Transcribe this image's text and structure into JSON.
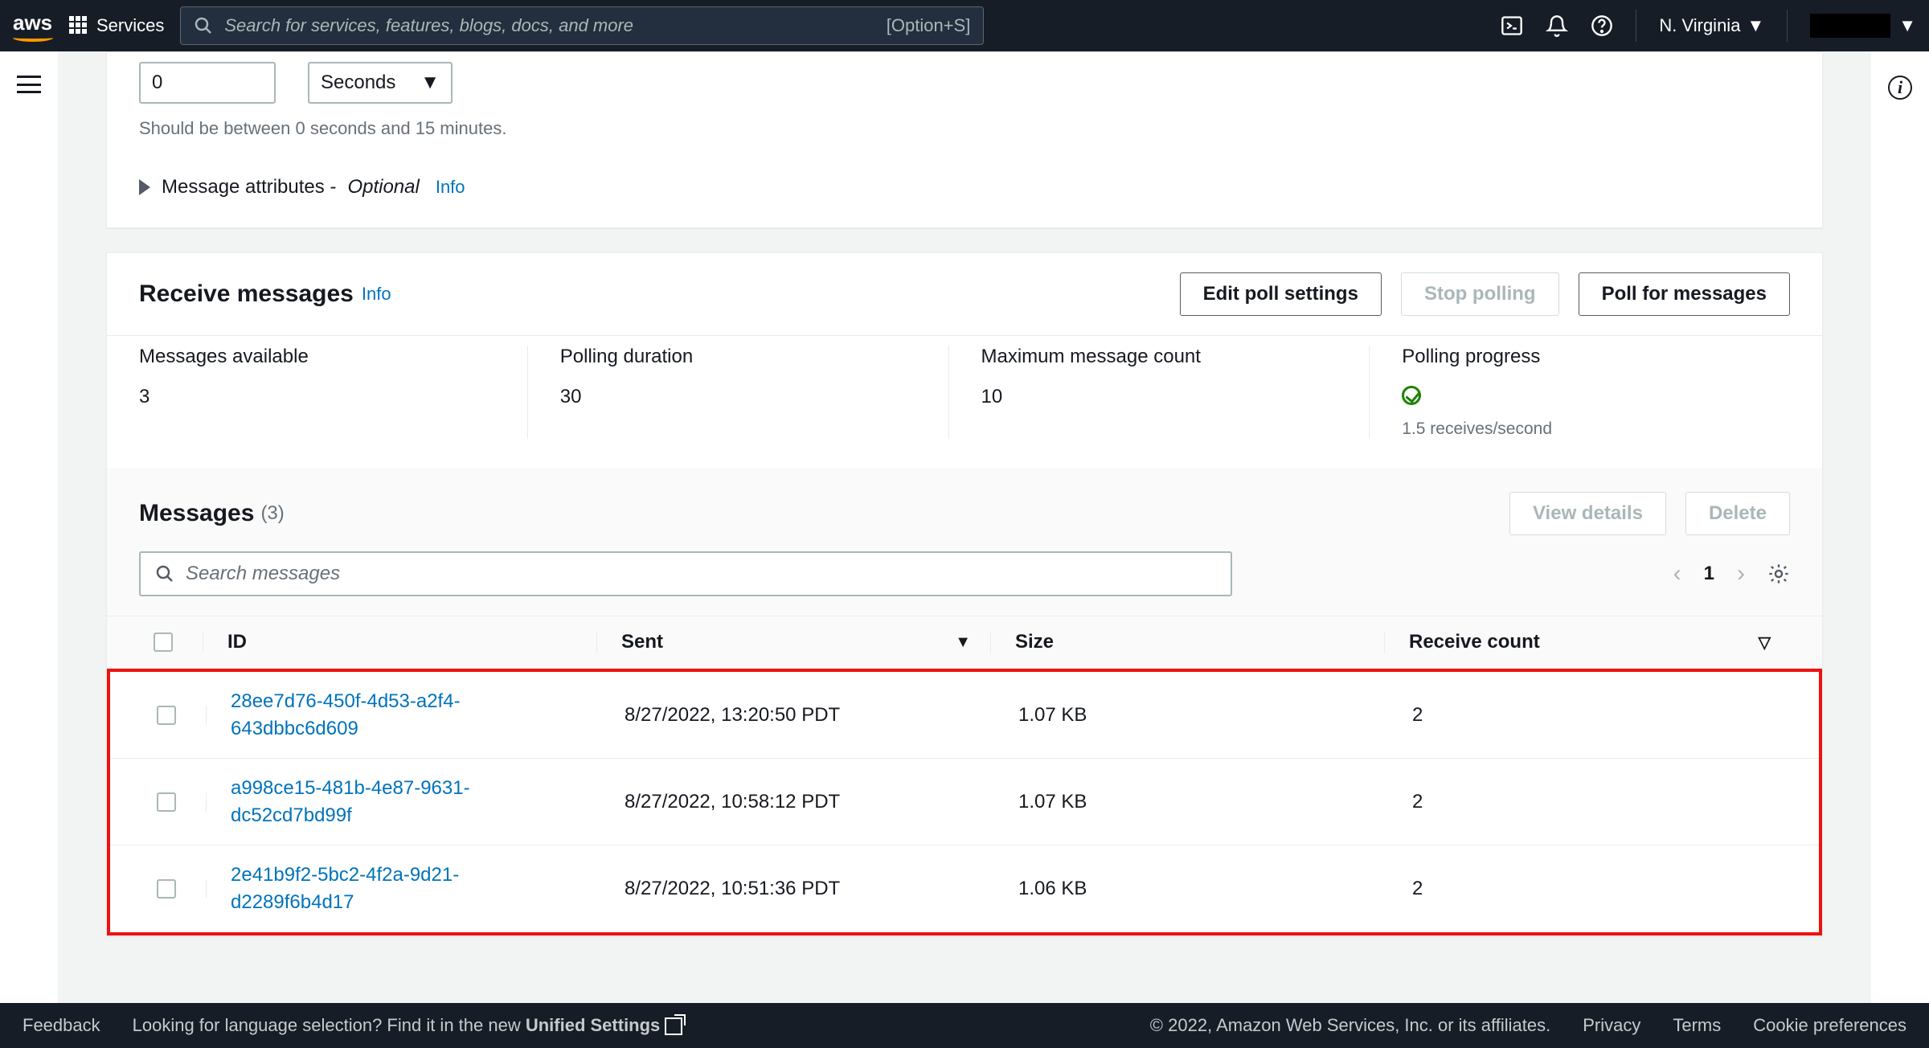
{
  "nav": {
    "logo_text": "aws",
    "services_label": "Services",
    "search_placeholder": "Search for services, features, blogs, docs, and more",
    "search_shortcut": "[Option+S]",
    "region": "N. Virginia"
  },
  "poll_panel": {
    "delay_value": "0",
    "unit_selected": "Seconds",
    "hint": "Should be between 0 seconds and 15 minutes.",
    "expander_label": "Message attributes - ",
    "expander_optional": "Optional",
    "expander_info": "Info"
  },
  "receive": {
    "title": "Receive messages",
    "info": "Info",
    "buttons": {
      "edit": "Edit poll settings",
      "stop": "Stop polling",
      "poll": "Poll for messages"
    },
    "stats": {
      "avail_label": "Messages available",
      "avail_val": "3",
      "dur_label": "Polling duration",
      "dur_val": "30",
      "max_label": "Maximum message count",
      "max_val": "10",
      "prog_label": "Polling progress",
      "prog_text": "1.5 receives/second"
    }
  },
  "messages_section": {
    "title": "Messages",
    "count": "(3)",
    "view_details": "View details",
    "delete": "Delete",
    "search_placeholder": "Search messages",
    "page": "1",
    "columns": {
      "id": "ID",
      "sent": "Sent",
      "size": "Size",
      "rc": "Receive count"
    },
    "rows": [
      {
        "id": "28ee7d76-450f-4d53-a2f4-643dbbc6d609",
        "sent": "8/27/2022, 13:20:50 PDT",
        "size": "1.07 KB",
        "rc": "2"
      },
      {
        "id": "a998ce15-481b-4e87-9631-dc52cd7bd99f",
        "sent": "8/27/2022, 10:58:12 PDT",
        "size": "1.07 KB",
        "rc": "2"
      },
      {
        "id": "2e41b9f2-5bc2-4f2a-9d21-d2289f6b4d17",
        "sent": "8/27/2022, 10:51:36 PDT",
        "size": "1.06 KB",
        "rc": "2"
      }
    ]
  },
  "footer": {
    "feedback": "Feedback",
    "lang_prompt": "Looking for language selection? Find it in the new ",
    "unified": "Unified Settings",
    "copyright": "© 2022, Amazon Web Services, Inc. or its affiliates.",
    "privacy": "Privacy",
    "terms": "Terms",
    "cookies": "Cookie preferences"
  }
}
